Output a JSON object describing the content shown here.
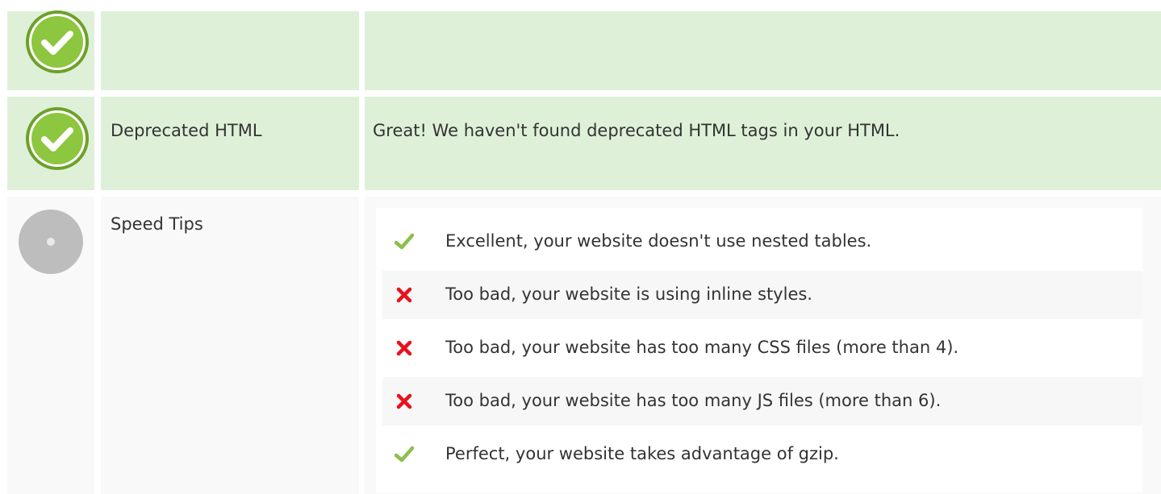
{
  "rows": [
    {
      "status": "pass",
      "label": "",
      "message": ""
    },
    {
      "status": "pass",
      "label": "Deprecated HTML",
      "message": "Great! We haven't found deprecated HTML tags in your HTML."
    },
    {
      "status": "neutral",
      "label": "Speed Tips"
    }
  ],
  "speed_tips": [
    {
      "status": "pass",
      "icon": "checkmark-icon",
      "text": "Excellent, your website doesn't use nested tables."
    },
    {
      "status": "fail",
      "icon": "cross-icon",
      "text": "Too bad, your website is using inline styles."
    },
    {
      "status": "fail",
      "icon": "cross-icon",
      "text": "Too bad, your website has too many CSS files (more than 4)."
    },
    {
      "status": "fail",
      "icon": "cross-icon",
      "text": "Too bad, your website has too many JS files (more than 6)."
    },
    {
      "status": "pass",
      "icon": "checkmark-icon",
      "text": "Perfect, your website takes advantage of gzip."
    }
  ],
  "colors": {
    "pass_row_bg": "#dff0d8",
    "neutral_row_bg": "#f9f9f9",
    "pass_badge": "#8dc63f",
    "neutral_badge": "#bdbdbd",
    "check_mark": "#8cc04a",
    "cross_mark": "#e8121c"
  }
}
